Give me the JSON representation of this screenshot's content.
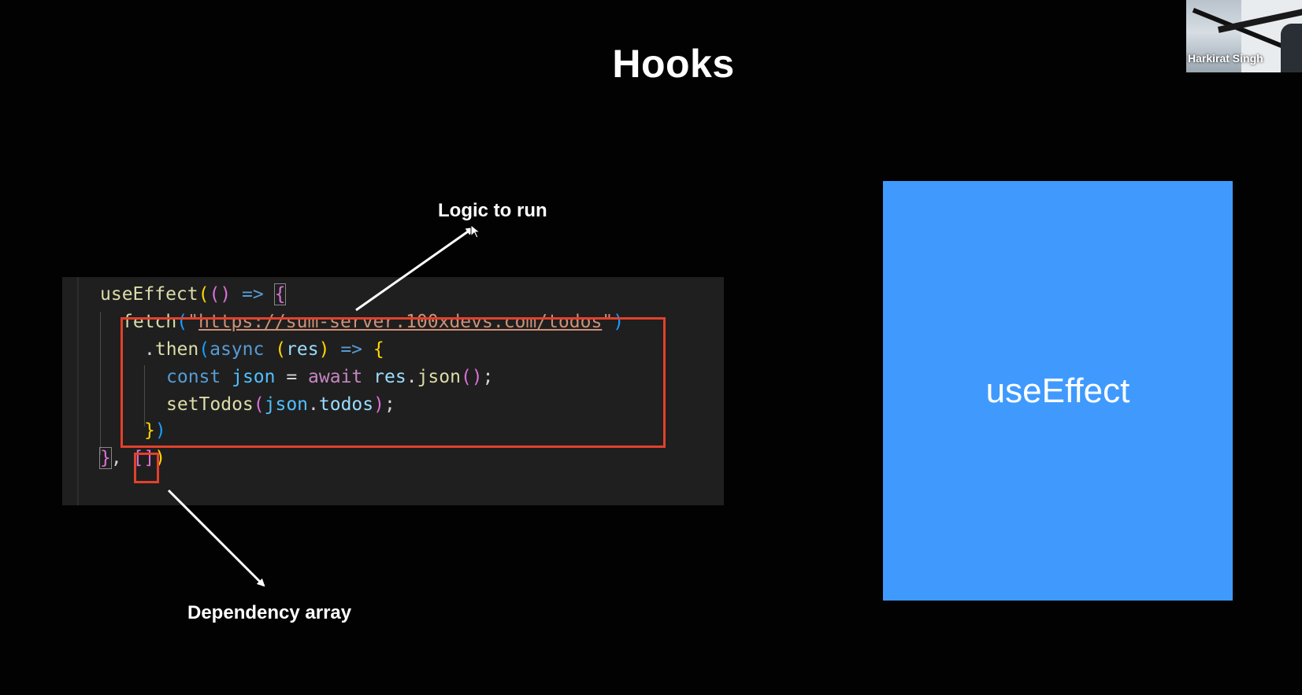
{
  "slide": {
    "title": "Hooks",
    "presenter_name": "Harkirat Singh",
    "annotations": {
      "logic_label": "Logic to run",
      "dependency_label": "Dependency array"
    },
    "card_label": "useEffect",
    "colors": {
      "background": "#020202",
      "card": "#409afe",
      "highlight_box": "#e2412c",
      "code_bg": "#1f1f1f"
    },
    "code": {
      "line1": {
        "fn": "useEffect",
        "open1": "(",
        "open2": "()",
        "arrow": " => ",
        "brace": "{"
      },
      "line2": {
        "fn": "fetch",
        "open": "(",
        "q1": "\"",
        "url": "https://sum-server.100xdevs.com/todos",
        "q2": "\"",
        "close": ")"
      },
      "line3": {
        "dot": ".",
        "fn": "then",
        "open": "(",
        "kw": "async",
        "sp": " ",
        "params_open": "(",
        "param": "res",
        "params_close": ")",
        "arrow": " => ",
        "brace": "{"
      },
      "line4": {
        "kw": "const",
        "var": "json",
        "eq": " = ",
        "await": "await",
        "obj": "res",
        "dot": ".",
        "fn": "json",
        "call": "()",
        "semi": ";"
      },
      "line5": {
        "fn": "setTodos",
        "open": "(",
        "obj": "json",
        "dot": ".",
        "prop": "todos",
        "close": ")",
        "semi": ";"
      },
      "line6": {
        "brace": "}",
        "close": ")"
      },
      "line7": {
        "brace": "}",
        "comma": ", ",
        "deps": "[]",
        "close": ")"
      }
    }
  }
}
